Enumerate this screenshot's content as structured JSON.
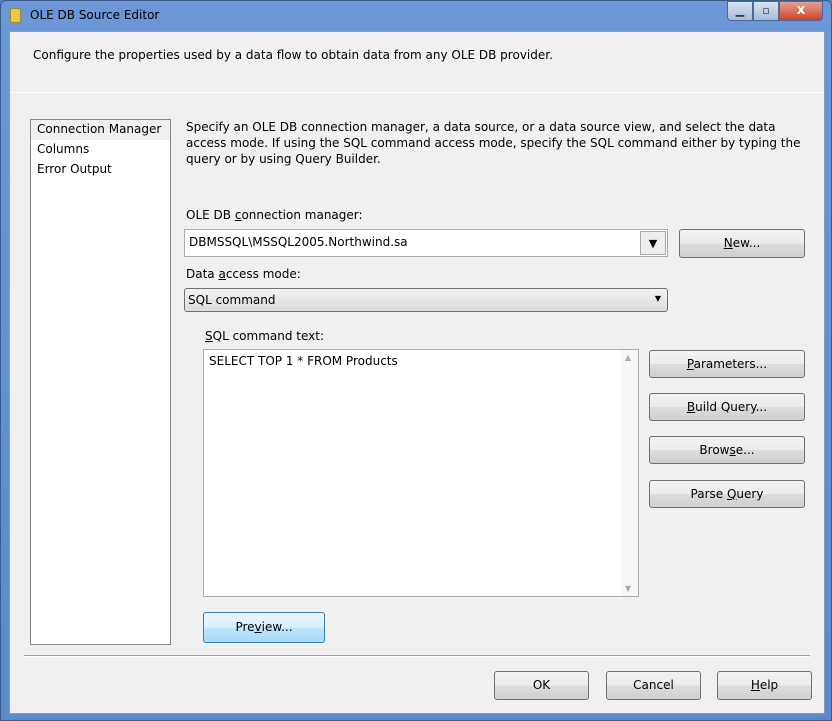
{
  "window": {
    "title": "OLE DB Source Editor",
    "minimize": "▁",
    "maximize": "▫",
    "close": "X"
  },
  "description": "Configure the properties used by a data flow to obtain data from any OLE DB provider.",
  "nav": {
    "items": [
      {
        "label": "Connection Manager",
        "selected": true
      },
      {
        "label": "Columns"
      },
      {
        "label": "Error Output"
      }
    ]
  },
  "main": {
    "instructions": "Specify an OLE DB connection manager, a data source, or a data source view, and select the data access mode. If using the SQL command access mode, specify the SQL command either by typing the query or by using Query Builder.",
    "conn_label_pre": "OLE DB ",
    "conn_label_u": "c",
    "conn_label_post": "onnection manager:",
    "conn_value": "DBMSSQL\\MSSQL2005.Northwind.sa",
    "new_u": "N",
    "new_rest": "ew...",
    "mode_label_pre": "Data ",
    "mode_label_u": "a",
    "mode_label_post": "ccess mode:",
    "mode_value": "SQL command",
    "sql_label_u": "S",
    "sql_label_rest": "QL command text:",
    "sql_text": "SELECT TOP 1 * FROM Products",
    "parameters_u": "P",
    "parameters_rest": "arameters...",
    "build_pre": "",
    "build_u": "B",
    "build_rest": "uild Query...",
    "browse_pre": "Brow",
    "browse_u": "s",
    "browse_rest": "e...",
    "parse_pre": "Parse ",
    "parse_u": "Q",
    "parse_rest": "uery",
    "preview_pre": "Pre",
    "preview_u": "v",
    "preview_rest": "iew..."
  },
  "footer": {
    "ok": "OK",
    "cancel": "Cancel",
    "help_u": "H",
    "help_rest": "elp"
  }
}
